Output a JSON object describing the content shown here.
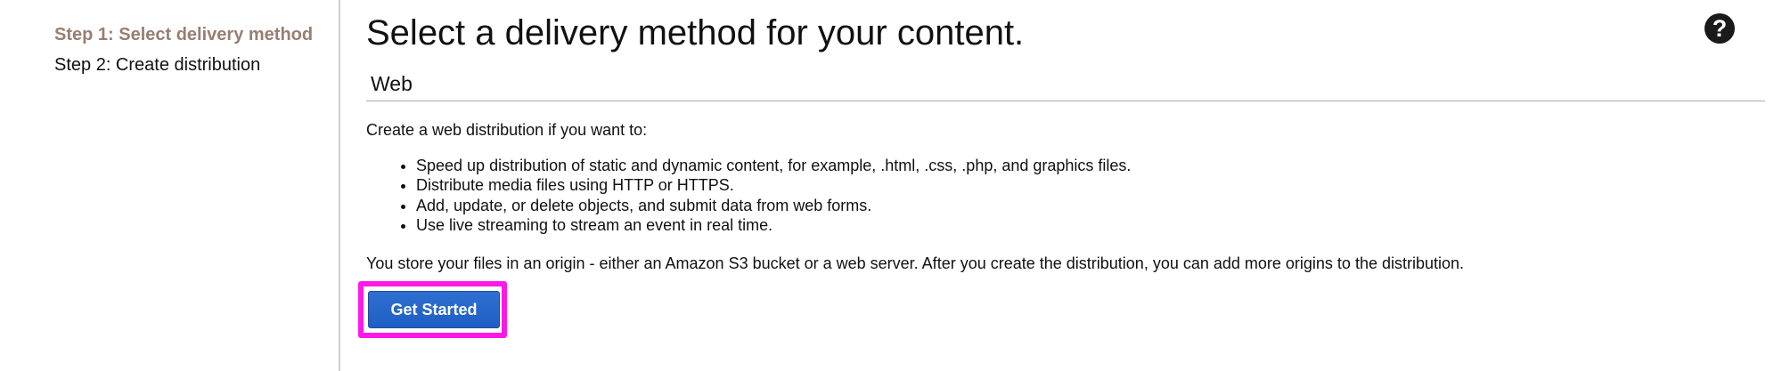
{
  "sidebar": {
    "steps": [
      {
        "label": "Step 1: Select delivery method",
        "active": true
      },
      {
        "label": "Step 2: Create distribution",
        "active": false
      }
    ]
  },
  "main": {
    "title": "Select a delivery method for your content.",
    "help_icon": "question-mark-circle-icon",
    "section": {
      "heading": "Web",
      "intro": "Create a web distribution if you want to:",
      "bullets": [
        "Speed up distribution of static and dynamic content, for example, .html, .css, .php, and graphics files.",
        "Distribute media files using HTTP or HTTPS.",
        "Add, update, or delete objects, and submit data from web forms.",
        "Use live streaming to stream an event in real time."
      ],
      "origin_note": "You store your files in an origin - either an Amazon S3 bucket or a web server. After you create the distribution, you can add more origins to the distribution.",
      "button_label": "Get Started"
    }
  },
  "colors": {
    "active_step": "#987e74",
    "button_blue": "#2466cb",
    "highlight_magenta": "#ff19e6",
    "divider": "#cfcfcf"
  }
}
